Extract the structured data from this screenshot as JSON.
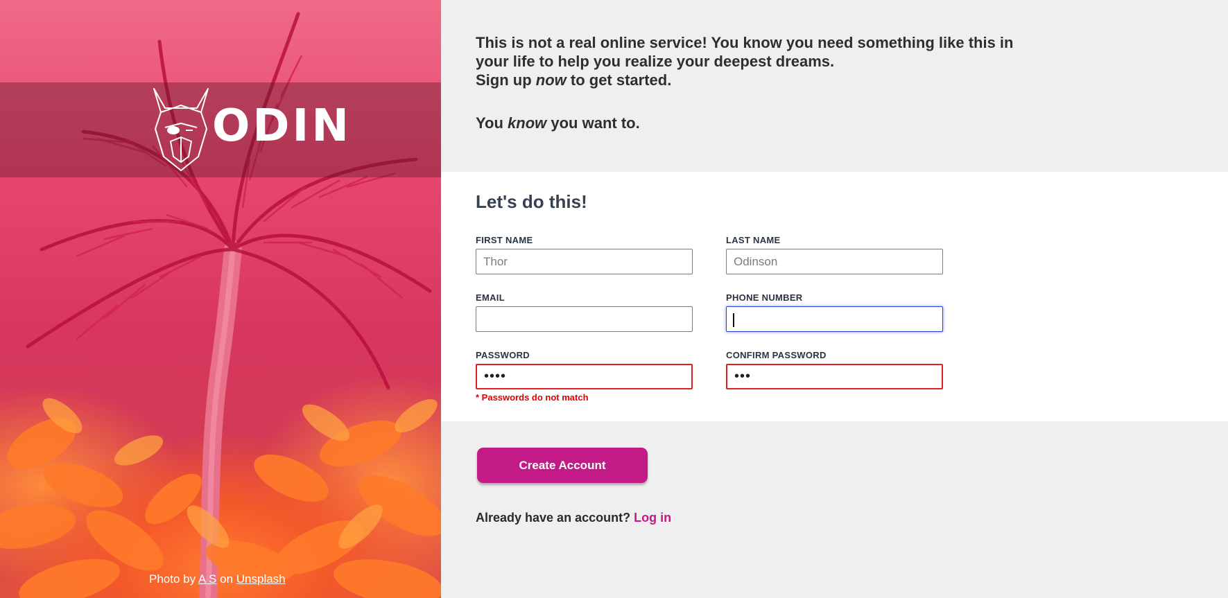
{
  "brand": {
    "name": "ODIN",
    "accent_color": "#c21a86",
    "logo_icon": "viking-helmet-icon"
  },
  "hero": {
    "credit_prefix": "Photo by",
    "credit_author": "A S",
    "credit_middle": "on",
    "credit_site": "Unsplash"
  },
  "intro": {
    "line1": "This is not a real online service! You know you need something like this in your life to help you realize your deepest dreams.",
    "line2_start": "Sign up ",
    "line2_em": "now",
    "line2_end": " to get started.",
    "line3_start": "You ",
    "line3_em": "know",
    "line3_end": " you want to."
  },
  "form": {
    "title": "Let's do this!",
    "fields": {
      "first_name": {
        "label": "First Name",
        "placeholder": "Thor",
        "value": ""
      },
      "last_name": {
        "label": "Last Name",
        "placeholder": "Odinson",
        "value": ""
      },
      "email": {
        "label": "Email",
        "placeholder": "",
        "value": ""
      },
      "phone": {
        "label": "Phone Number",
        "placeholder": "",
        "value": "",
        "state": "focused"
      },
      "password": {
        "label": "Password",
        "value": "••••",
        "state": "error"
      },
      "confirm_password": {
        "label": "Confirm Password",
        "value": "•••",
        "state": "error"
      }
    },
    "error_message": "* Passwords do not match",
    "error_color": "#e00000",
    "submit_label": "Create Account"
  },
  "login": {
    "prompt": "Already have an account?",
    "link_label": "Log in"
  }
}
